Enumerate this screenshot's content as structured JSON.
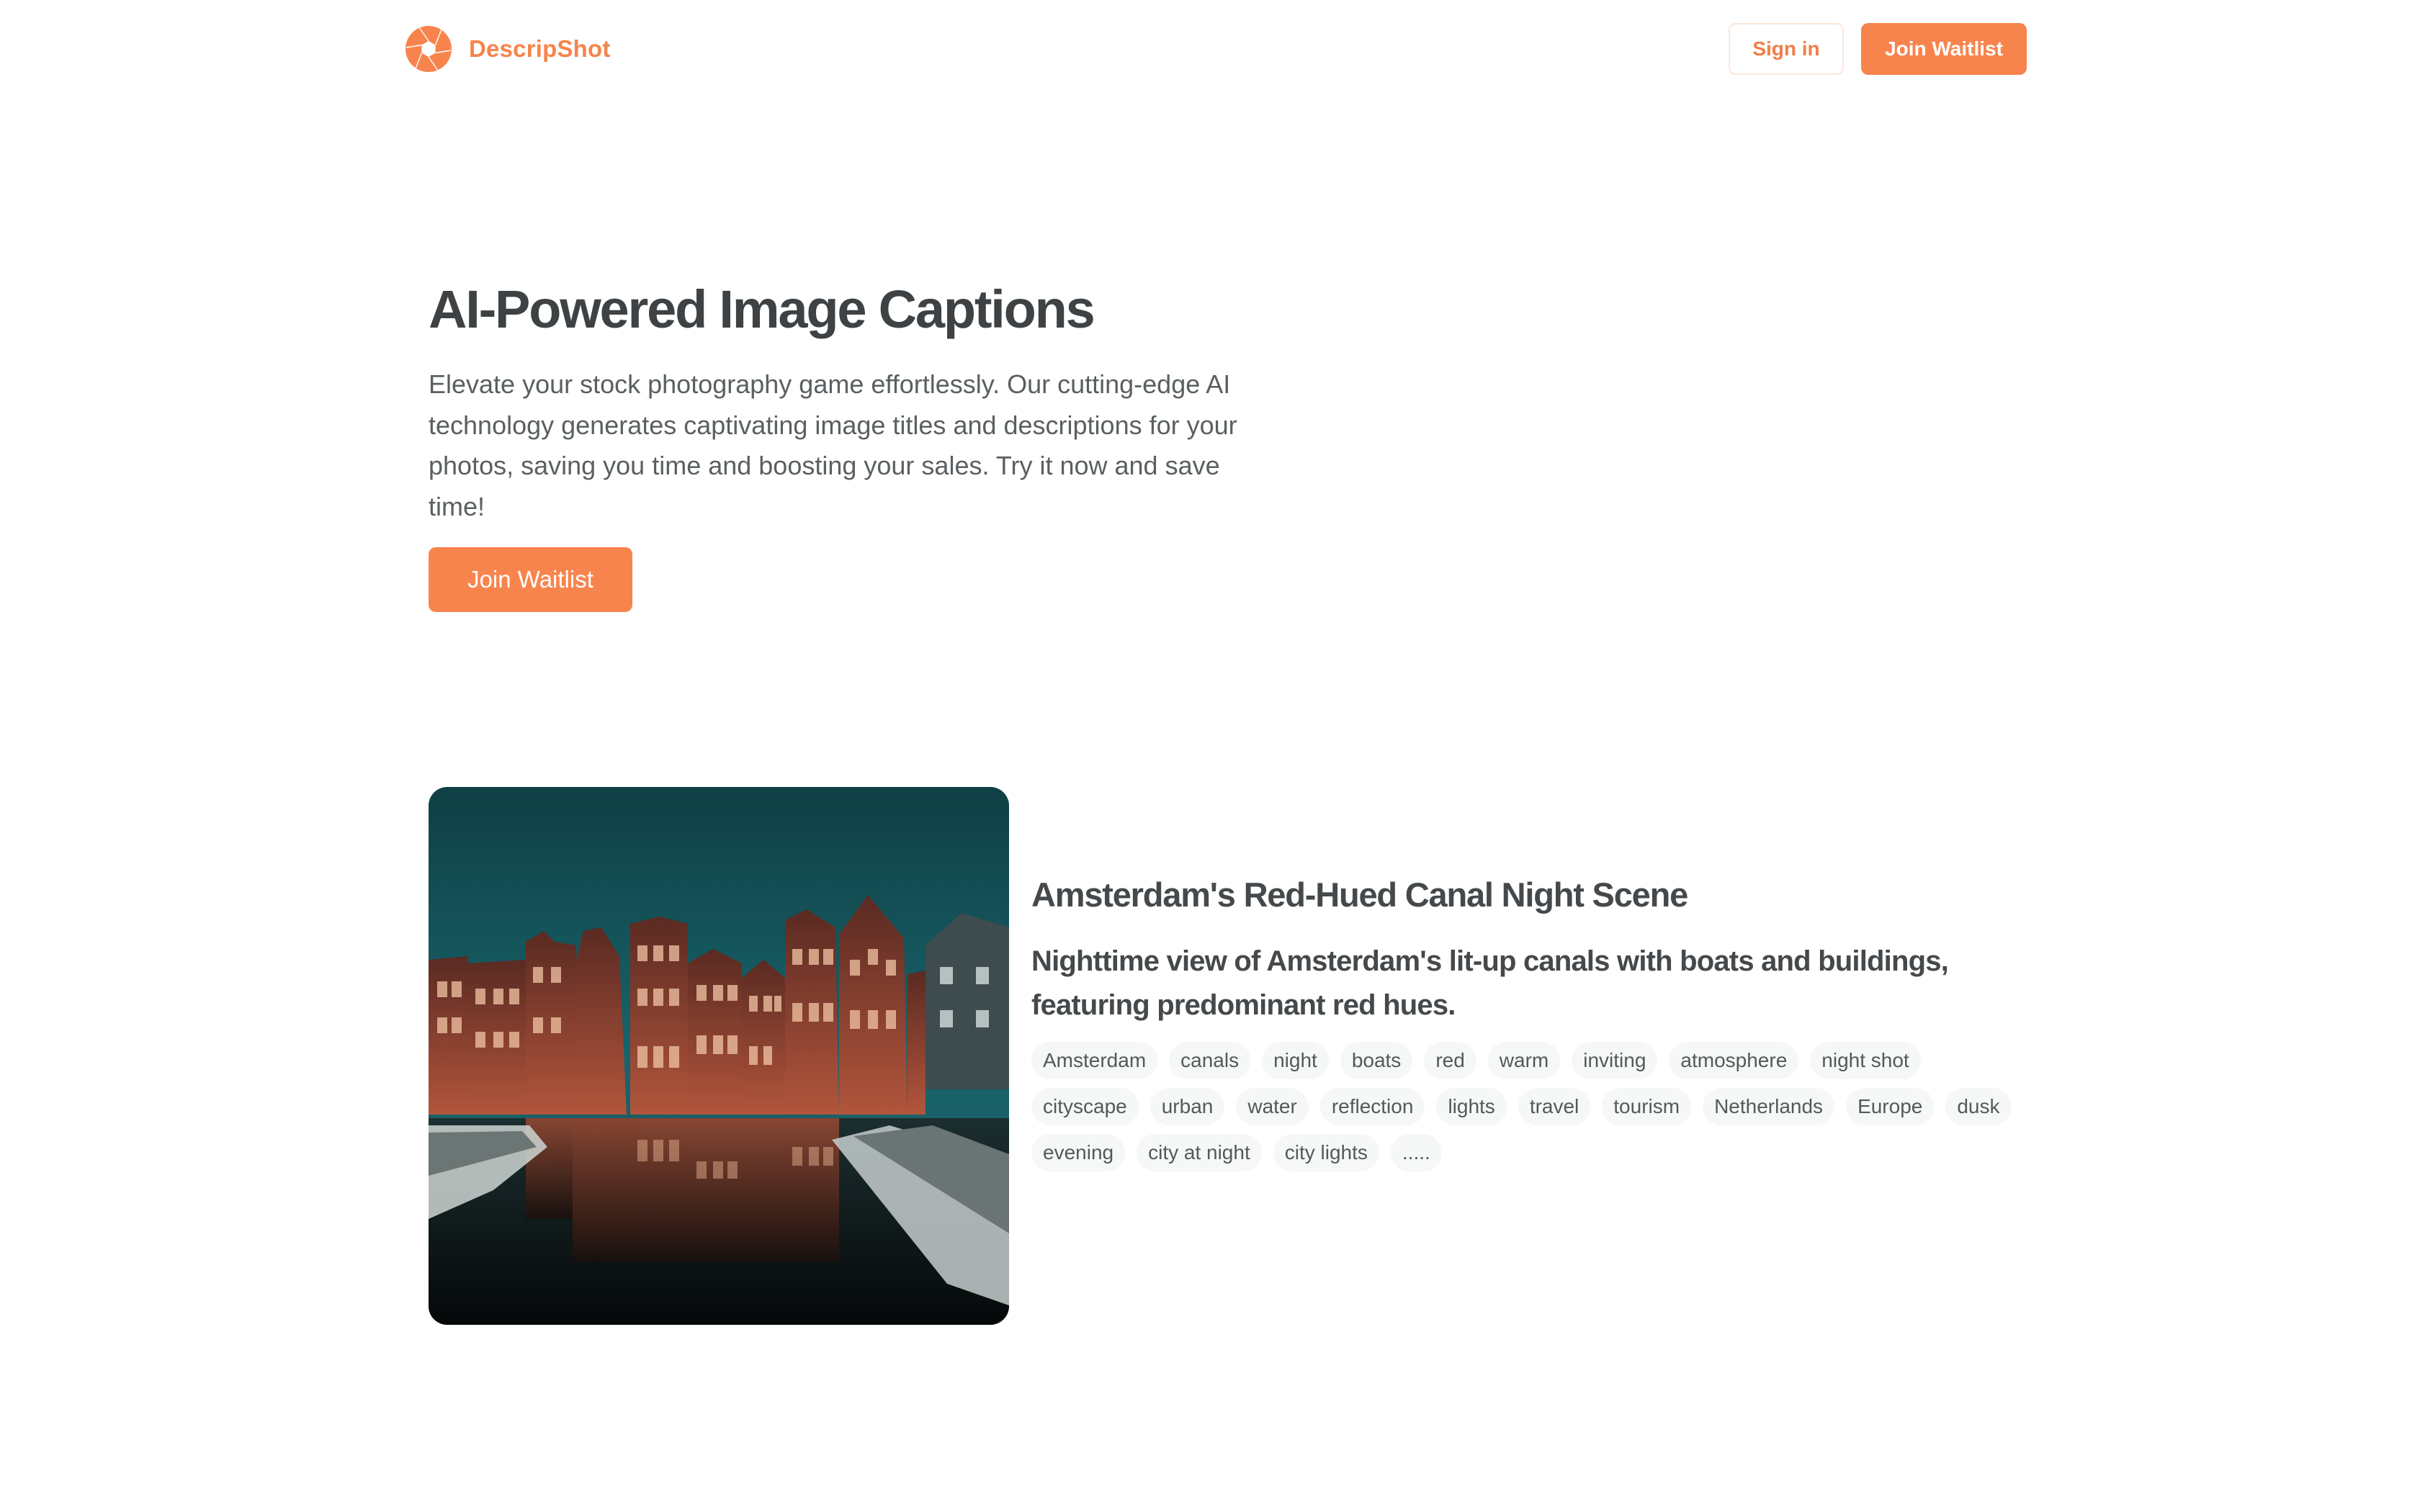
{
  "brand": {
    "name": "DescripShot",
    "logo_icon": "camera-aperture-icon",
    "accent_color": "#f8844d"
  },
  "nav": {
    "sign_in_label": "Sign in",
    "join_waitlist_label": "Join Waitlist"
  },
  "hero": {
    "title": "AI-Powered Image Captions",
    "description": "Elevate your stock photography game effortlessly. Our cutting-edge AI technology generates captivating image titles and descriptions for your photos, saving you time and boosting your sales. Try it now and save time!",
    "cta_label": "Join Waitlist"
  },
  "example": {
    "image_alt": "Amsterdam canal houses at night reflected in water with tour boats",
    "title": "Amsterdam's Red-Hued Canal Night Scene",
    "description": "Nighttime view of Amsterdam's lit-up canals with boats and buildings, featuring predominant red hues.",
    "tags": [
      "Amsterdam",
      "canals",
      "night",
      "boats",
      "red",
      "warm",
      "inviting",
      "atmosphere",
      "night shot",
      "cityscape",
      "urban",
      "water",
      "reflection",
      "lights",
      "travel",
      "tourism",
      "Netherlands",
      "Europe",
      "dusk",
      "evening",
      "city at night",
      "city lights",
      "....."
    ]
  }
}
